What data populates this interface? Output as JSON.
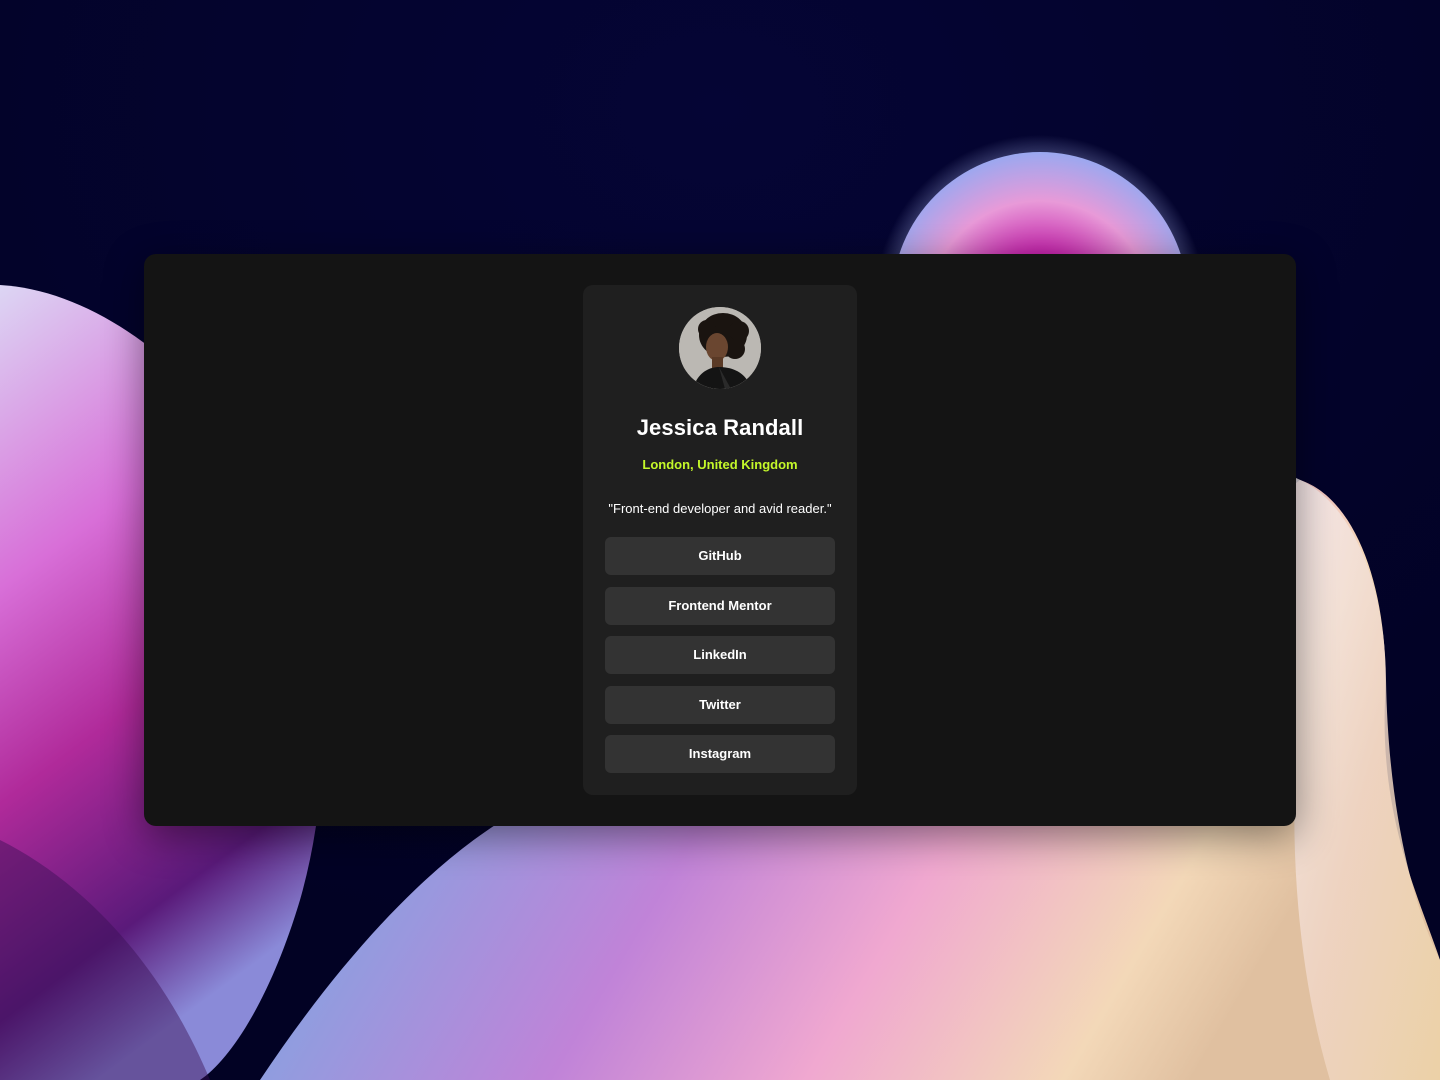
{
  "profile": {
    "name": "Jessica Randall",
    "location": "London, United Kingdom",
    "bio": "\"Front-end developer and avid reader.\"",
    "accent_color": "#c4f82a"
  },
  "links": [
    {
      "label": "GitHub"
    },
    {
      "label": "Frontend Mentor"
    },
    {
      "label": "LinkedIn"
    },
    {
      "label": "Twitter"
    },
    {
      "label": "Instagram"
    }
  ],
  "theme": {
    "window_bg": "#141414",
    "card_bg": "#1f1f1f",
    "button_bg": "#333333"
  }
}
